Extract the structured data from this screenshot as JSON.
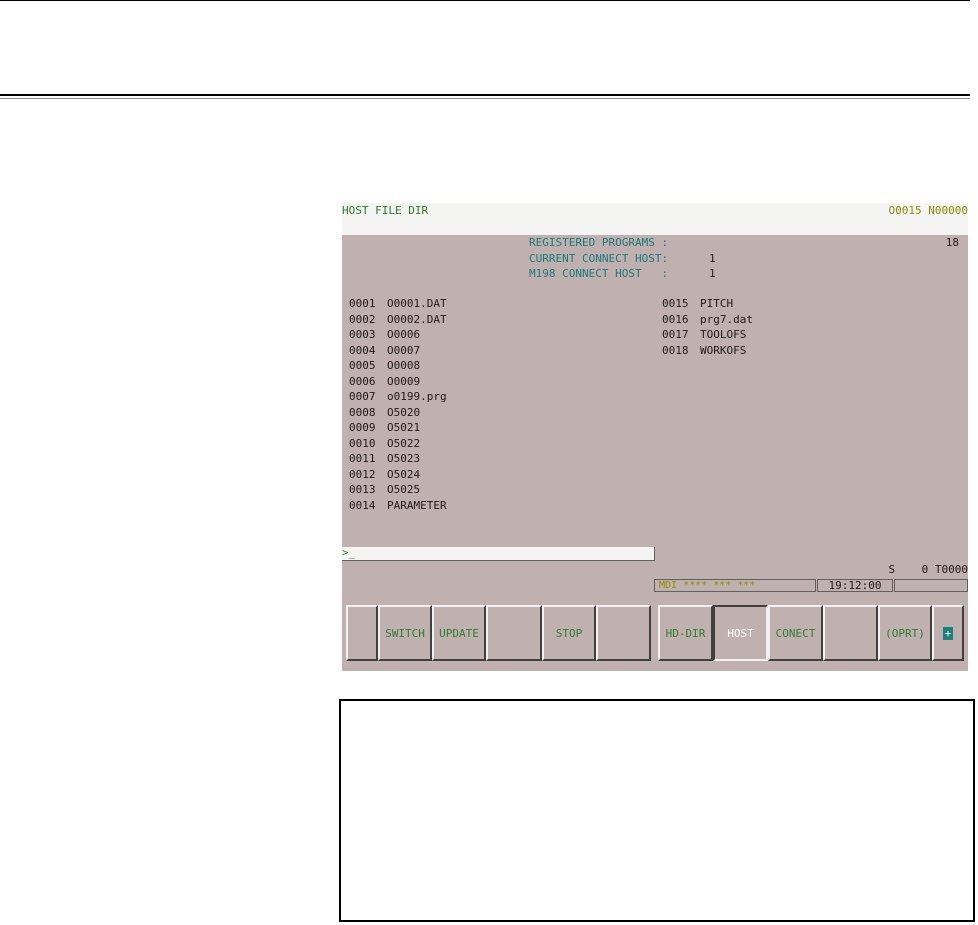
{
  "screen": {
    "title": "HOST FILE DIR",
    "program_info": "O0015 N00000"
  },
  "info": {
    "registered_label": "REGISTERED PROGRAMS :",
    "registered_value": "18",
    "current_host_label": "CURRENT CONNECT HOST:",
    "current_host_value": "1",
    "m198_host_label": "M198 CONNECT HOST   :",
    "m198_host_value": "1"
  },
  "files": [
    {
      "num": "0001",
      "name": "O0001.DAT"
    },
    {
      "num": "0002",
      "name": "O0002.DAT"
    },
    {
      "num": "0003",
      "name": "O0006"
    },
    {
      "num": "0004",
      "name": "O0007"
    },
    {
      "num": "0005",
      "name": "O0008"
    },
    {
      "num": "0006",
      "name": "O0009"
    },
    {
      "num": "0007",
      "name": "o0199.prg"
    },
    {
      "num": "0008",
      "name": "O5020"
    },
    {
      "num": "0009",
      "name": "O5021"
    },
    {
      "num": "0010",
      "name": "O5022"
    },
    {
      "num": "0011",
      "name": "O5023"
    },
    {
      "num": "0012",
      "name": "O5024"
    },
    {
      "num": "0013",
      "name": "O5025"
    },
    {
      "num": "0014",
      "name": "PARAMETER"
    },
    {
      "num": "0015",
      "name": "PITCH"
    },
    {
      "num": "0016",
      "name": "prg7.dat"
    },
    {
      "num": "0017",
      "name": "TOOLOFS"
    },
    {
      "num": "0018",
      "name": "WORKOFS"
    }
  ],
  "command_line": {
    "prompt": ">_"
  },
  "spindle": {
    "text": "S    0 T0000"
  },
  "status": {
    "mode": "MDI **** *** ***",
    "time": "19:12:00"
  },
  "softkeys": {
    "switch": "SWITCH",
    "update": "UPDATE",
    "stop": "STOP",
    "hd_dir": "HD-DIR",
    "host": "HOST",
    "conect": "CONECT",
    "oprt": "(OPRT)",
    "more": "+"
  },
  "colors": {
    "screen_bg": "#c0b0b0",
    "label_cyan": "#1a7a7a",
    "key_text": "#2f7d2f"
  }
}
